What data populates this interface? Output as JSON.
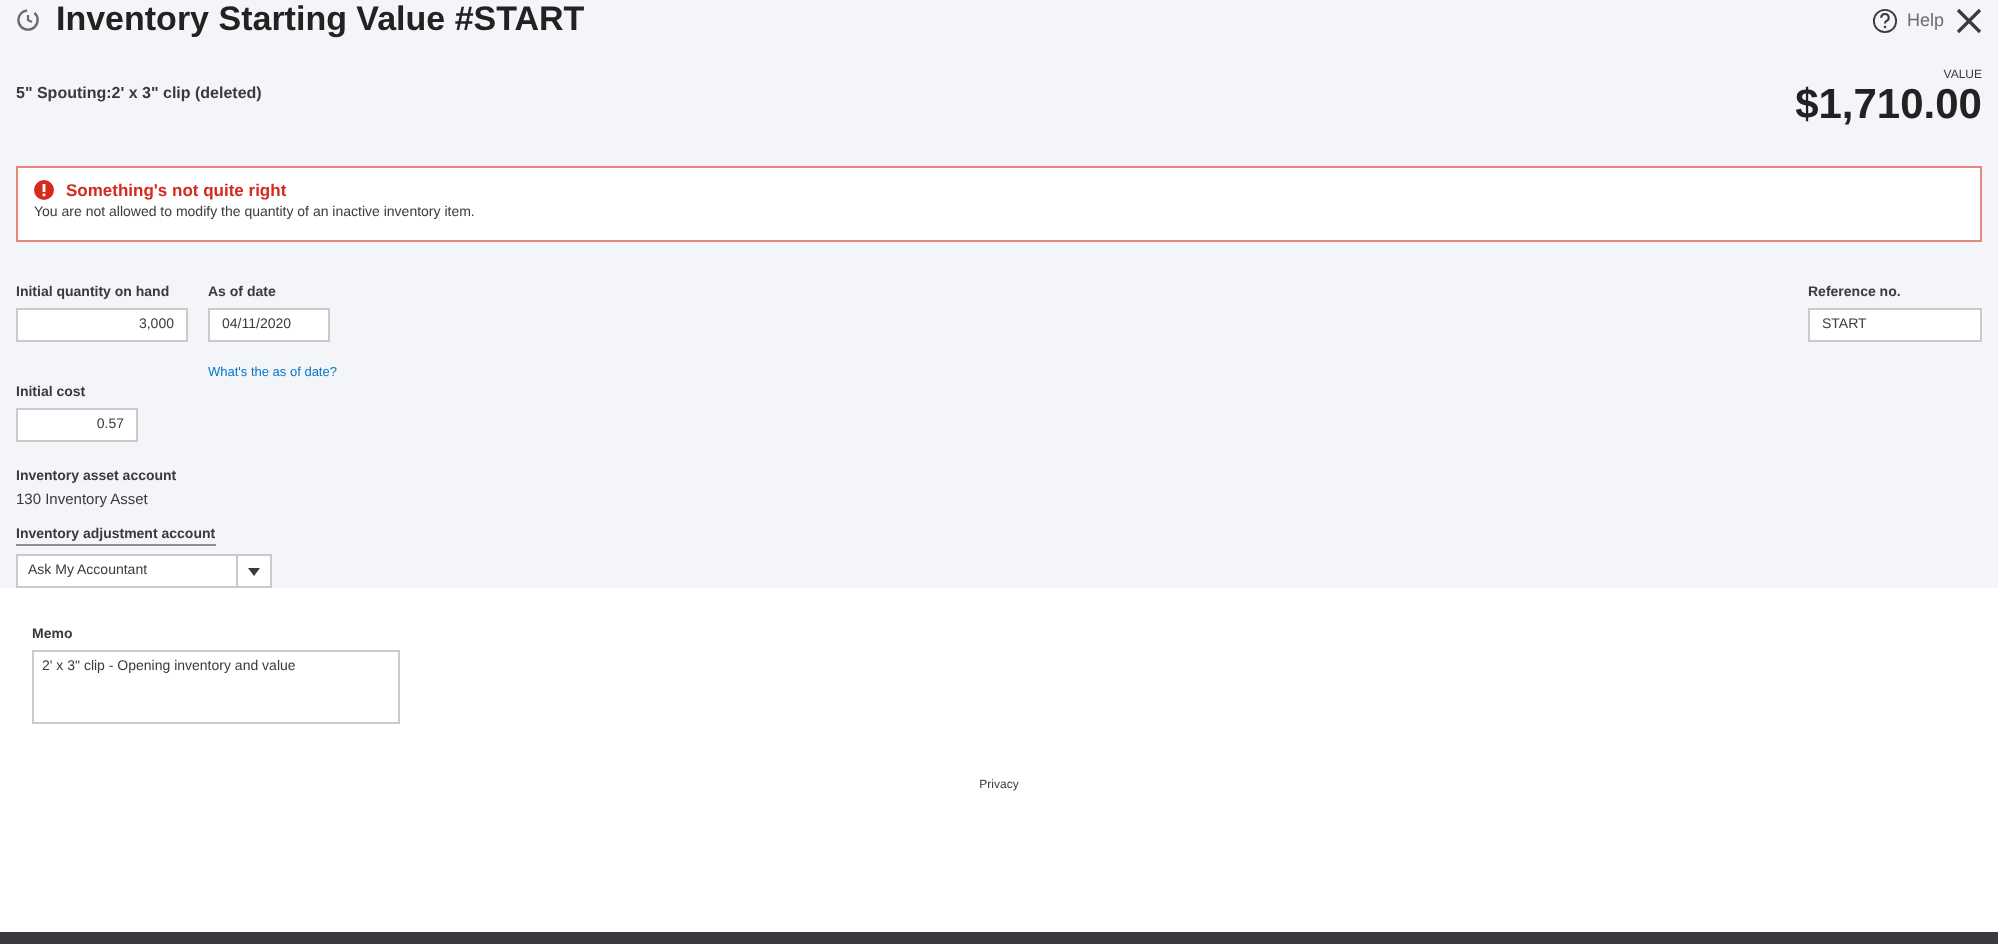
{
  "header": {
    "title": "Inventory Starting Value #START",
    "help": "Help"
  },
  "item_name": "5\" Spouting:2' x 3\" clip (deleted)",
  "value": {
    "label": "VALUE",
    "amount": "$1,710.00"
  },
  "error": {
    "title": "Something's not quite right",
    "message": "You are not allowed to modify the quantity of an inactive inventory item."
  },
  "fields": {
    "initial_quantity": {
      "label": "Initial quantity on hand",
      "value": "3,000"
    },
    "as_of_date": {
      "label": "As of date",
      "value": "04/11/2020",
      "help_link": "What's the as of date?"
    },
    "reference_no": {
      "label": "Reference no.",
      "value": "START"
    },
    "initial_cost": {
      "label": "Initial cost",
      "value": "0.57"
    },
    "asset_account": {
      "label": "Inventory asset account",
      "value": "130 Inventory Asset"
    },
    "adjustment_account": {
      "label": "Inventory adjustment account",
      "value": "Ask My Accountant"
    }
  },
  "memo": {
    "label": "Memo",
    "value": "2' x 3\" clip - Opening inventory and value"
  },
  "footer_link": "Privacy"
}
